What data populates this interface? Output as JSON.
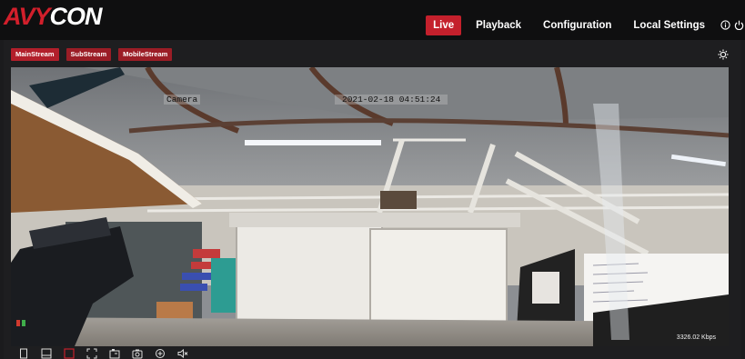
{
  "brand": {
    "logo_part_a": "AVY",
    "logo_part_b": "CON"
  },
  "nav": {
    "live": "Live",
    "playback": "Playback",
    "configuration": "Configuration",
    "local_settings": "Local Settings"
  },
  "streams": {
    "main": "MainStream",
    "sub": "SubStream",
    "mobile": "MobileStream"
  },
  "video": {
    "camera_name": "Camera",
    "timestamp": "2021-02-18 04:51:24",
    "bitrate": "3326.02 Kbps"
  },
  "colors": {
    "accent": "#c4202c",
    "tab": "#9b1d26",
    "background": "#1b1b1d"
  },
  "icons": {
    "info": "info-icon",
    "power": "power-icon",
    "brightness": "brightness-icon",
    "toolbar": [
      "single-view-icon",
      "quad-view-icon",
      "record-icon",
      "fullscreen-icon",
      "snapshot-icon",
      "camera-icon",
      "zoom-icon",
      "audio-icon"
    ]
  }
}
